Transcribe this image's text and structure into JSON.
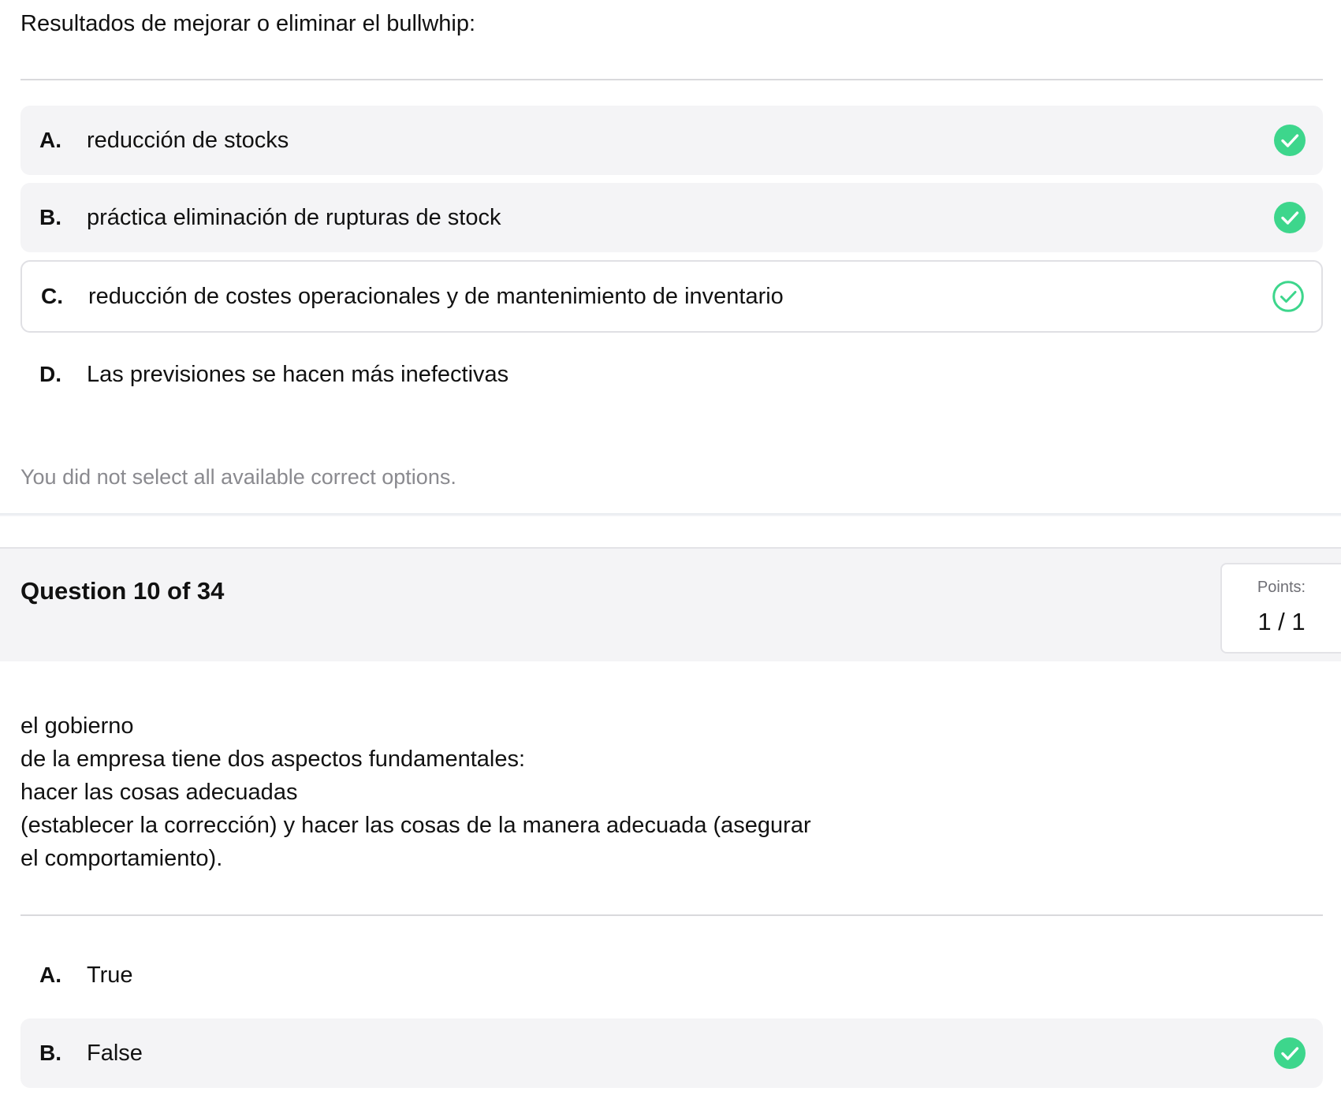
{
  "question9": {
    "prompt": "Resultados de mejorar o eliminar el bullwhip:",
    "options": [
      {
        "letter": "A.",
        "text": "reducción de stocks",
        "state": "selected-correct",
        "icon": "check-circle-filled-icon"
      },
      {
        "letter": "B.",
        "text": "práctica eliminación de rupturas de stock",
        "state": "selected-correct",
        "icon": "check-circle-filled-icon"
      },
      {
        "letter": "C.",
        "text": "reducción de costes operacionales y de mantenimiento de inventario",
        "state": "missed-correct",
        "icon": "check-circle-outline-icon"
      },
      {
        "letter": "D.",
        "text": "Las previsiones se hacen más inefectivas",
        "state": "unselected",
        "icon": ""
      }
    ],
    "feedback": "You did not select all available correct options."
  },
  "question10": {
    "title": "Question 10 of 34",
    "points_label": "Points:",
    "points_value": "1 / 1",
    "prompt_lines": [
      "el gobierno",
      "de la empresa tiene dos aspectos fundamentales:",
      "hacer las cosas adecuadas",
      "(establecer la corrección) y hacer las cosas de la manera adecuada (asegurar",
      "el comportamiento)."
    ],
    "options": [
      {
        "letter": "A.",
        "text": "True",
        "state": "unselected",
        "icon": ""
      },
      {
        "letter": "B.",
        "text": "False",
        "state": "selected-correct",
        "icon": "check-circle-filled-icon"
      }
    ]
  },
  "colors": {
    "correct_green": "#3dd68c",
    "option_bg": "#f4f4f6",
    "text": "#111111",
    "muted_text": "#8a8a8f"
  }
}
